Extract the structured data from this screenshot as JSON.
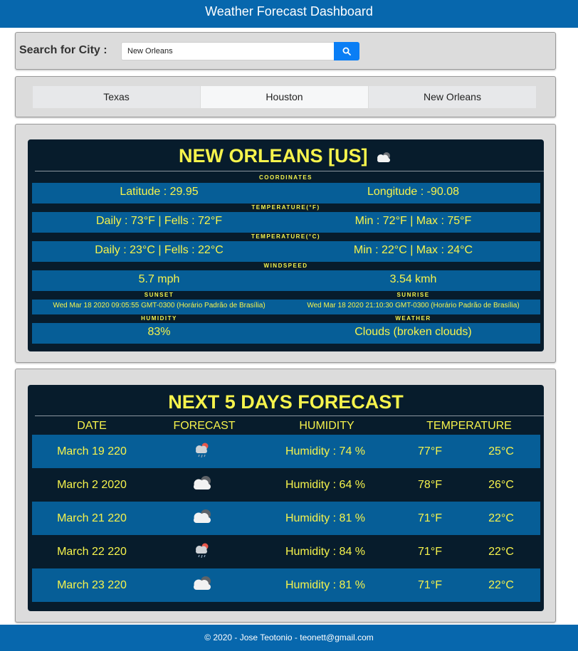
{
  "header": {
    "title": "Weather Forecast Dashboard"
  },
  "search": {
    "label": "Search for City :",
    "value": "New Orleans",
    "button_icon": "search-icon"
  },
  "tabs": [
    {
      "label": "Texas"
    },
    {
      "label": "Houston"
    },
    {
      "label": "New Orleans"
    }
  ],
  "current": {
    "title": "NEW ORLEANS [US]",
    "icon": "cloud-icon",
    "coordinates": {
      "label": "COORDINATES",
      "lat": "Latitude : 29.95",
      "lon": "Longitude : -90.08"
    },
    "temp_f": {
      "label": "TEMPERATURE(°F)",
      "daily": "Daily : 73°F | Fells : 72°F",
      "minmax": "Min : 72°F | Max : 75°F"
    },
    "temp_c": {
      "label": "TEMPERATURE(°C)",
      "daily": "Daily : 23°C | Fells : 22°C",
      "minmax": "Min : 22°C | Max : 24°C"
    },
    "wind": {
      "label": "WINDSPEED",
      "mph": "5.7 mph",
      "kmh": "3.54 kmh"
    },
    "sun": {
      "sunset_label": "SUNSET",
      "sunrise_label": "SUNRISE",
      "sunset": "Wed Mar 18 2020 09:05:55 GMT-0300 (Horário Padrão de Brasília)",
      "sunrise": "Wed Mar 18 2020 21:10:30 GMT-0300 (Horário Padrão de Brasília)"
    },
    "hum": {
      "humidity_label": "HUMIDITY",
      "weather_label": "WEATHER",
      "humidity": "83%",
      "weather": "Clouds (broken clouds)"
    }
  },
  "forecast": {
    "title": "NEXT 5 DAYS FORECAST",
    "headers": {
      "date": "DATE",
      "forecast": "FORECAST",
      "humidity": "HUMIDITY",
      "temperature": "TEMPERATURE"
    },
    "rows": [
      {
        "date": "March 19 220",
        "icon": "rain-cloud-icon",
        "humidity": "Humidity : 74 %",
        "temp_f": "77°F",
        "temp_c": "25°C"
      },
      {
        "date": "March 2 2020",
        "icon": "cloud-icon",
        "humidity": "Humidity : 64 %",
        "temp_f": "78°F",
        "temp_c": "26°C"
      },
      {
        "date": "March 21 220",
        "icon": "cloud-icon",
        "humidity": "Humidity : 81 %",
        "temp_f": "71°F",
        "temp_c": "22°C"
      },
      {
        "date": "March 22 220",
        "icon": "rain-cloud-icon",
        "humidity": "Humidity : 84 %",
        "temp_f": "71°F",
        "temp_c": "22°C"
      },
      {
        "date": "March 23 220",
        "icon": "cloud-icon",
        "humidity": "Humidity : 81 %",
        "temp_f": "71°F",
        "temp_c": "22°C"
      }
    ]
  },
  "footer": {
    "text": "© 2020 - Jose Teotonio - teonett@gmail.com"
  }
}
